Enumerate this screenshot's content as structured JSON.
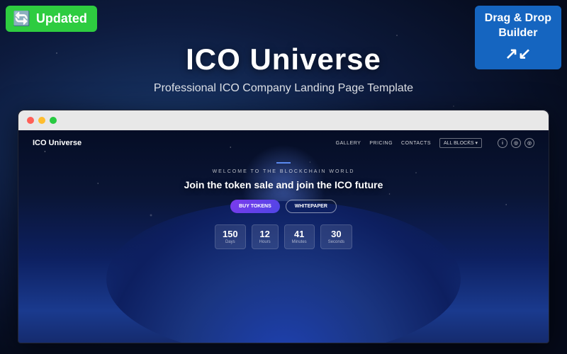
{
  "badge_updated": {
    "label": "Updated",
    "icon": "🔄"
  },
  "badge_dnd": {
    "line1": "Drag & Drop",
    "line2": "Builder",
    "icon": "↗↙"
  },
  "hero": {
    "title": "ICO Universe",
    "subtitle": "Professional ICO Company Landing Page Template"
  },
  "browser": {
    "nav": {
      "brand": "ICO Universe",
      "links": [
        "GALLERY",
        "PRICING",
        "CONTACTS"
      ],
      "blocks_label": "ALL BLOCKS ▾"
    },
    "welcome_line": "WELCOME TO THE BLOCKCHAIN WORLD",
    "hero_title": "Join the token sale and join the ICO future",
    "buttons": {
      "buy_tokens": "BUY TOKENS",
      "whitepaper": "WHITEPAPER"
    },
    "countdown": [
      {
        "value": "150",
        "label": "Days"
      },
      {
        "value": "12",
        "label": "Hours"
      },
      {
        "value": "41",
        "label": "Minutes"
      },
      {
        "value": "30",
        "label": "Seconds"
      }
    ]
  },
  "colors": {
    "updated_bg": "#2ecc40",
    "dnd_bg": "#1565c0",
    "accent_purple": "#7c3aed",
    "accent_blue": "#4f46e5",
    "countdown_bg": "rgba(255,255,255,0.1)"
  }
}
